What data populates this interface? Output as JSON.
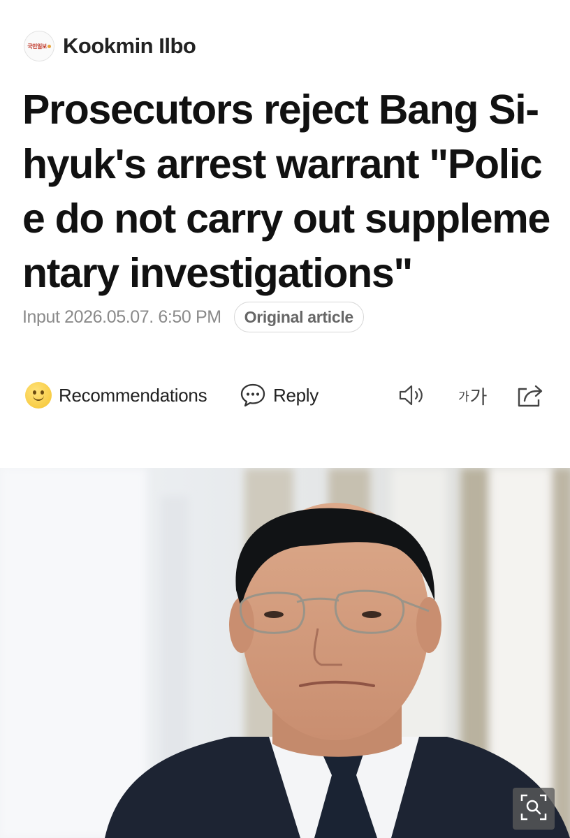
{
  "publisher": {
    "logo_text": "국민일보",
    "name": "Kookmin Ilbo"
  },
  "article": {
    "headline": "Prosecutors reject Bang Si-hyuk's arrest warrant \"Police do not carry out supplementary investigations\"",
    "input_label": "Input 2026.05.07. 6:50 PM",
    "original_article_label": "Original article"
  },
  "actions": {
    "recommendations_label": "Recommendations",
    "reply_label": "Reply",
    "listen_icon": "speaker-icon",
    "font_size_small": "가",
    "font_size_big": "가",
    "share_icon": "share-icon"
  },
  "photo": {
    "zoom_icon": "zoom-icon"
  },
  "colors": {
    "meta_gray": "#8a8a8a",
    "headline": "#111111",
    "smiley": "#f5c430"
  }
}
